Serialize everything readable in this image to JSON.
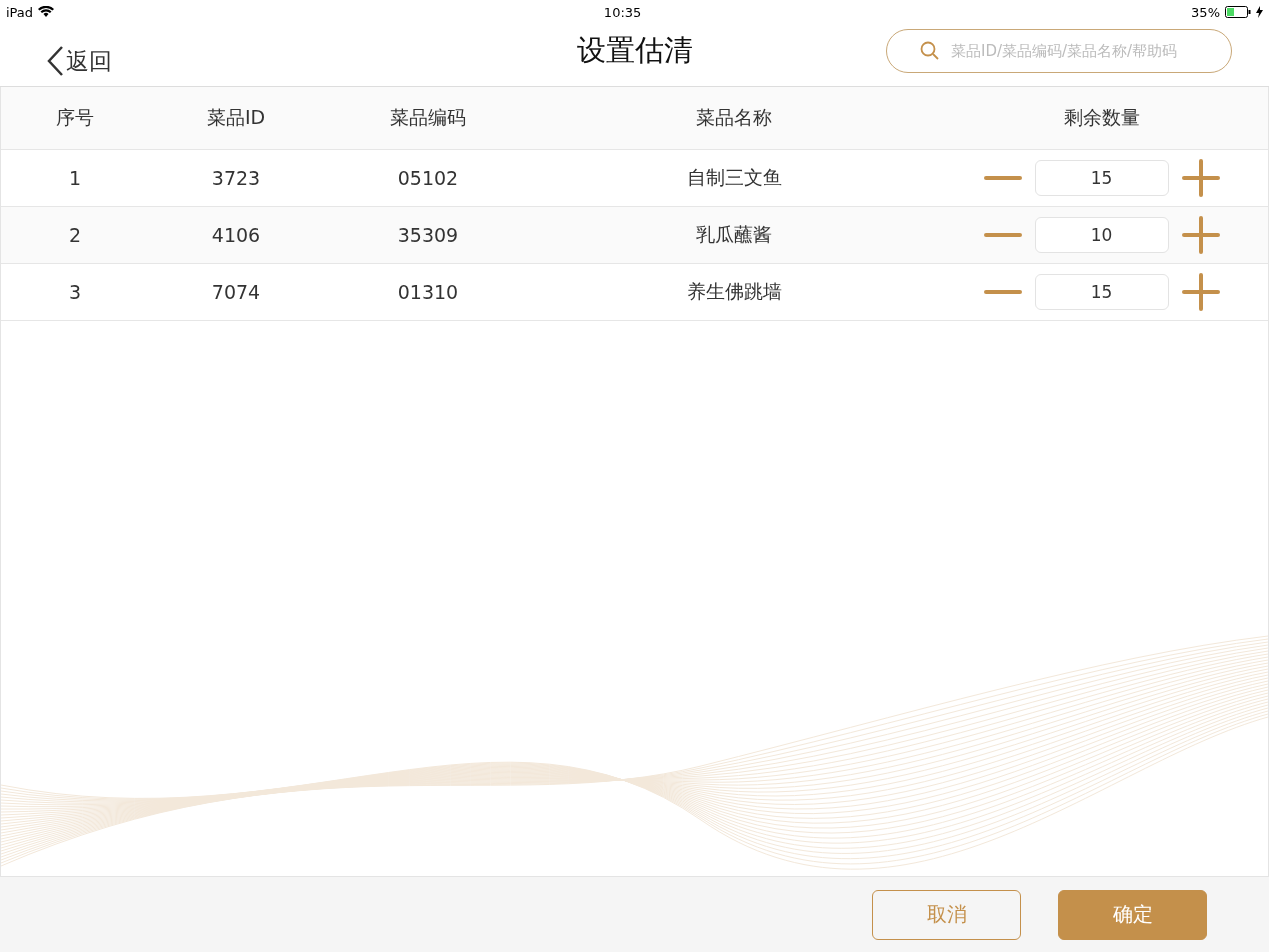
{
  "status_bar": {
    "device": "iPad",
    "time": "10:35",
    "battery": "35%"
  },
  "nav": {
    "back": "返回",
    "title": "设置估清",
    "search": {
      "placeholder": "菜品ID/菜品编码/菜品名称/帮助码"
    }
  },
  "table": {
    "columns": [
      "序号",
      "菜品ID",
      "菜品编码",
      "菜品名称",
      "剩余数量"
    ],
    "rows": [
      {
        "index": "1",
        "id": "3723",
        "code": "05102",
        "name": "自制三文鱼",
        "quantity": "15"
      },
      {
        "index": "2",
        "id": "4106",
        "code": "35309",
        "name": "乳瓜蘸酱",
        "quantity": "10"
      },
      {
        "index": "3",
        "id": "7074",
        "code": "01310",
        "name": "养生佛跳墙",
        "quantity": "15"
      }
    ]
  },
  "buttons": [
    {
      "label": "取消",
      "kind": "secondary"
    },
    {
      "label": "确定",
      "kind": "primary"
    }
  ]
}
